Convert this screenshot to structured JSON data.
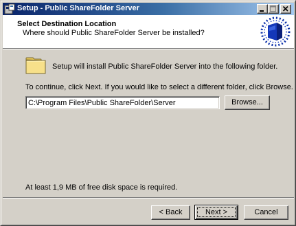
{
  "window": {
    "title": "Setup - Public ShareFolder Server",
    "app_icon": "setup-app-icon",
    "controls": [
      "minimize-icon",
      "maximize-icon",
      "close-icon"
    ]
  },
  "header": {
    "title": "Select Destination Location",
    "subtitle": "Where should Public ShareFolder Server be installed?",
    "logo": "wizard-logo-icon"
  },
  "body": {
    "folder_icon": "folder-icon",
    "install_message": "Setup will install Public ShareFolder Server into the following folder.",
    "continue_message": "To continue, click Next. If you would like to select a different folder, click Browse.",
    "path_value": "C:\\Program Files\\Public ShareFolder\\Server",
    "browse_label": "Browse...",
    "disk_space_message": "At least 1,9 MB of free disk space is required."
  },
  "footer": {
    "back_label": "< Back",
    "next_label": "Next >",
    "cancel_label": "Cancel"
  },
  "colors": {
    "title_bar_start": "#0a246a",
    "title_bar_end": "#a6caf0",
    "dialog_face": "#d4d0c8",
    "header_bg": "#ffffff",
    "folder_yellow": "#f7e08a"
  }
}
